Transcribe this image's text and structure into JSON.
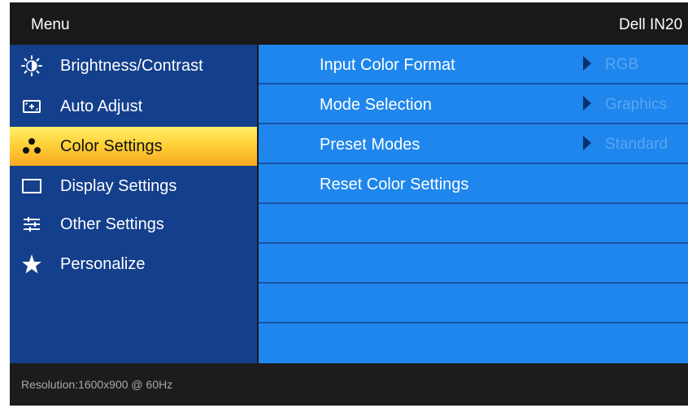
{
  "header": {
    "menu_label": "Menu",
    "model_label": "Dell IN20"
  },
  "sidebar": {
    "items": [
      {
        "label": "Brightness/Contrast",
        "icon": "brightness-icon"
      },
      {
        "label": "Auto Adjust",
        "icon": "auto-adjust-icon"
      },
      {
        "label": "Color Settings",
        "icon": "color-settings-icon",
        "selected": true
      },
      {
        "label": "Display Settings",
        "icon": "display-settings-icon"
      },
      {
        "label": "Other Settings",
        "icon": "other-settings-icon"
      },
      {
        "label": "Personalize",
        "icon": "star-icon"
      }
    ]
  },
  "main": {
    "rows": [
      {
        "label": "Input Color Format",
        "value": "RGB"
      },
      {
        "label": "Mode Selection",
        "value": "Graphics"
      },
      {
        "label": "Preset Modes",
        "value": "Standard"
      },
      {
        "label": "Reset Color Settings",
        "value": ""
      }
    ]
  },
  "footer": {
    "resolution": "Resolution:1600x900 @ 60Hz"
  },
  "colors": {
    "sidebar_bg": "#143f8c",
    "panel_bg": "#1e86ec",
    "selected_highlight": "#ffd238",
    "frame_bg": "#1c1a1a",
    "value_text": "#5aa6f2"
  }
}
